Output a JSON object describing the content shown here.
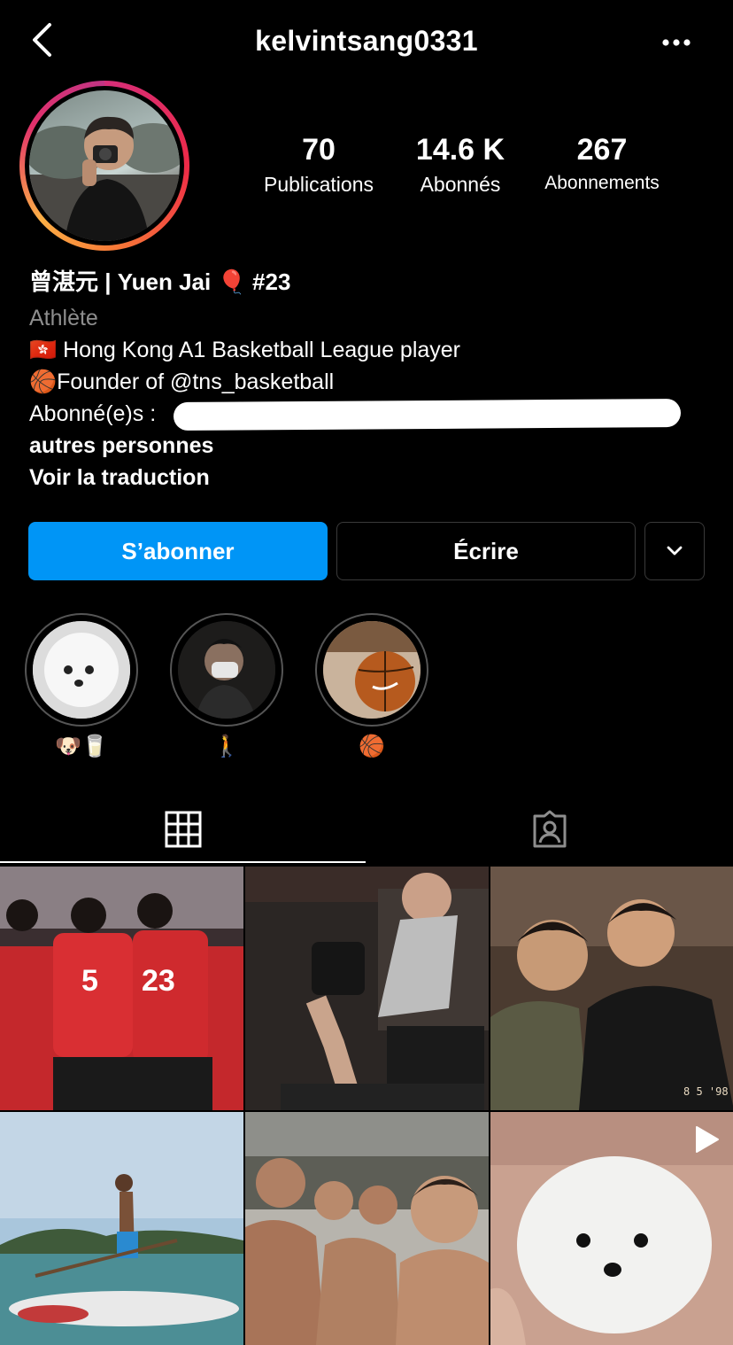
{
  "header": {
    "username": "kelvintsang0331",
    "back_icon": "chevron-left-icon",
    "more_icon": "more-horizontal-icon"
  },
  "stats": [
    {
      "value": "70",
      "label": "Publications"
    },
    {
      "value": "14.6 K",
      "label": "Abonnés"
    },
    {
      "value": "267",
      "label": "Abonnements"
    }
  ],
  "bio": {
    "name": "曾湛元 | Yuen Jai 🎈 #23",
    "category": "Athlète",
    "line1": "🇭🇰 Hong Kong A1 Basketball League player",
    "line2": "🏀Founder of @tns_basketball",
    "followed_by_prefix": "Abonné(e)s :",
    "followed_by_suffix": "autres personnes",
    "translate": "Voir la traduction"
  },
  "buttons": {
    "follow": "S’abonner",
    "message": "Écrire",
    "dropdown_icon": "chevron-down-icon"
  },
  "highlights": [
    {
      "label": "🐶🥛"
    },
    {
      "label": "🚶"
    },
    {
      "label": "🏀"
    }
  ],
  "tabs": {
    "active": "grid",
    "items": [
      {
        "name": "grid",
        "icon": "grid-icon"
      },
      {
        "name": "tagged",
        "icon": "tagged-user-icon"
      }
    ]
  },
  "posts": [
    {
      "desc": "team-huddle-red-jerseys"
    },
    {
      "desc": "gym-dumbbell-row"
    },
    {
      "desc": "two-friends-selfie",
      "stamp": "8 5 '98"
    },
    {
      "desc": "paddleboard-sea"
    },
    {
      "desc": "group-selfie-beach"
    },
    {
      "desc": "white-puppy",
      "video": true
    }
  ],
  "colors": {
    "background": "#000000",
    "follow_button": "#0095f6",
    "secondary_text": "#8e8e8e"
  }
}
